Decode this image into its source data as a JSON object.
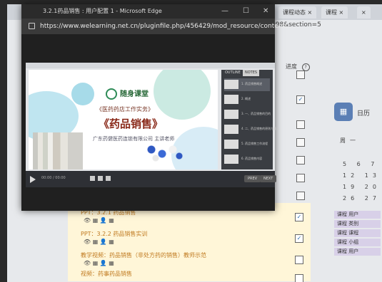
{
  "browser": {
    "title": "3.2.1药品销售 : 用户配置 1 - Microsoft Edge",
    "controls": {
      "minimize": "—",
      "maximize": "☐",
      "close": "✕"
    },
    "url": "https://www.welearning.net.cn/pluginfile.php/456429/mod_resource/content/..."
  },
  "background_page": {
    "tabs": [
      {
        "label": "课程动态 ×"
      },
      {
        "label": "课程 ×"
      },
      {
        "label": "×"
      }
    ],
    "url_tail": "998&section=5",
    "progress_label": "进度",
    "help_icon": "?",
    "course_items": [
      {
        "label": "PPT：3.2.1 药品销售",
        "checked": true
      },
      {
        "label": "PPT：3.2.2 药品销售实训",
        "checked": true
      },
      {
        "label": "教学视频：药品销售（非处方药的销售）教师示范",
        "checked": false
      },
      {
        "label": "视频：药事药品销售",
        "checked": false
      }
    ],
    "right_checkboxes": [
      false,
      true,
      false,
      false,
      false,
      false,
      false,
      false
    ],
    "calendar": {
      "title": "日历",
      "weekday_label": "周一",
      "rows": [
        "5 6 7",
        "12 13 14",
        "19 20 21",
        "26 27 28"
      ]
    },
    "legend_items": [
      "课程 用户",
      "课程 类别",
      "课程 课程",
      "课程 小组",
      "课程 用户"
    ]
  },
  "slide": {
    "logo": "随身课堂",
    "subtitle": "《医药药店工作实务》",
    "title": "《药品销售》",
    "organization": "广东药健医药连锁有限公司 主讲老师"
  },
  "outline_panel": {
    "tabs": [
      "OUTLINE",
      "NOTES"
    ],
    "items": [
      "1. 药品销售概述",
      "2. 概述",
      "3. 一、药品销售的目的",
      "4. 二、药品销售的原则与意义",
      "5. 药品销售工作流程",
      "6. 药品销售内容"
    ]
  },
  "player_controls": {
    "time": "00:00 / 00:00",
    "prev": "PREV",
    "next": "NEXT"
  }
}
